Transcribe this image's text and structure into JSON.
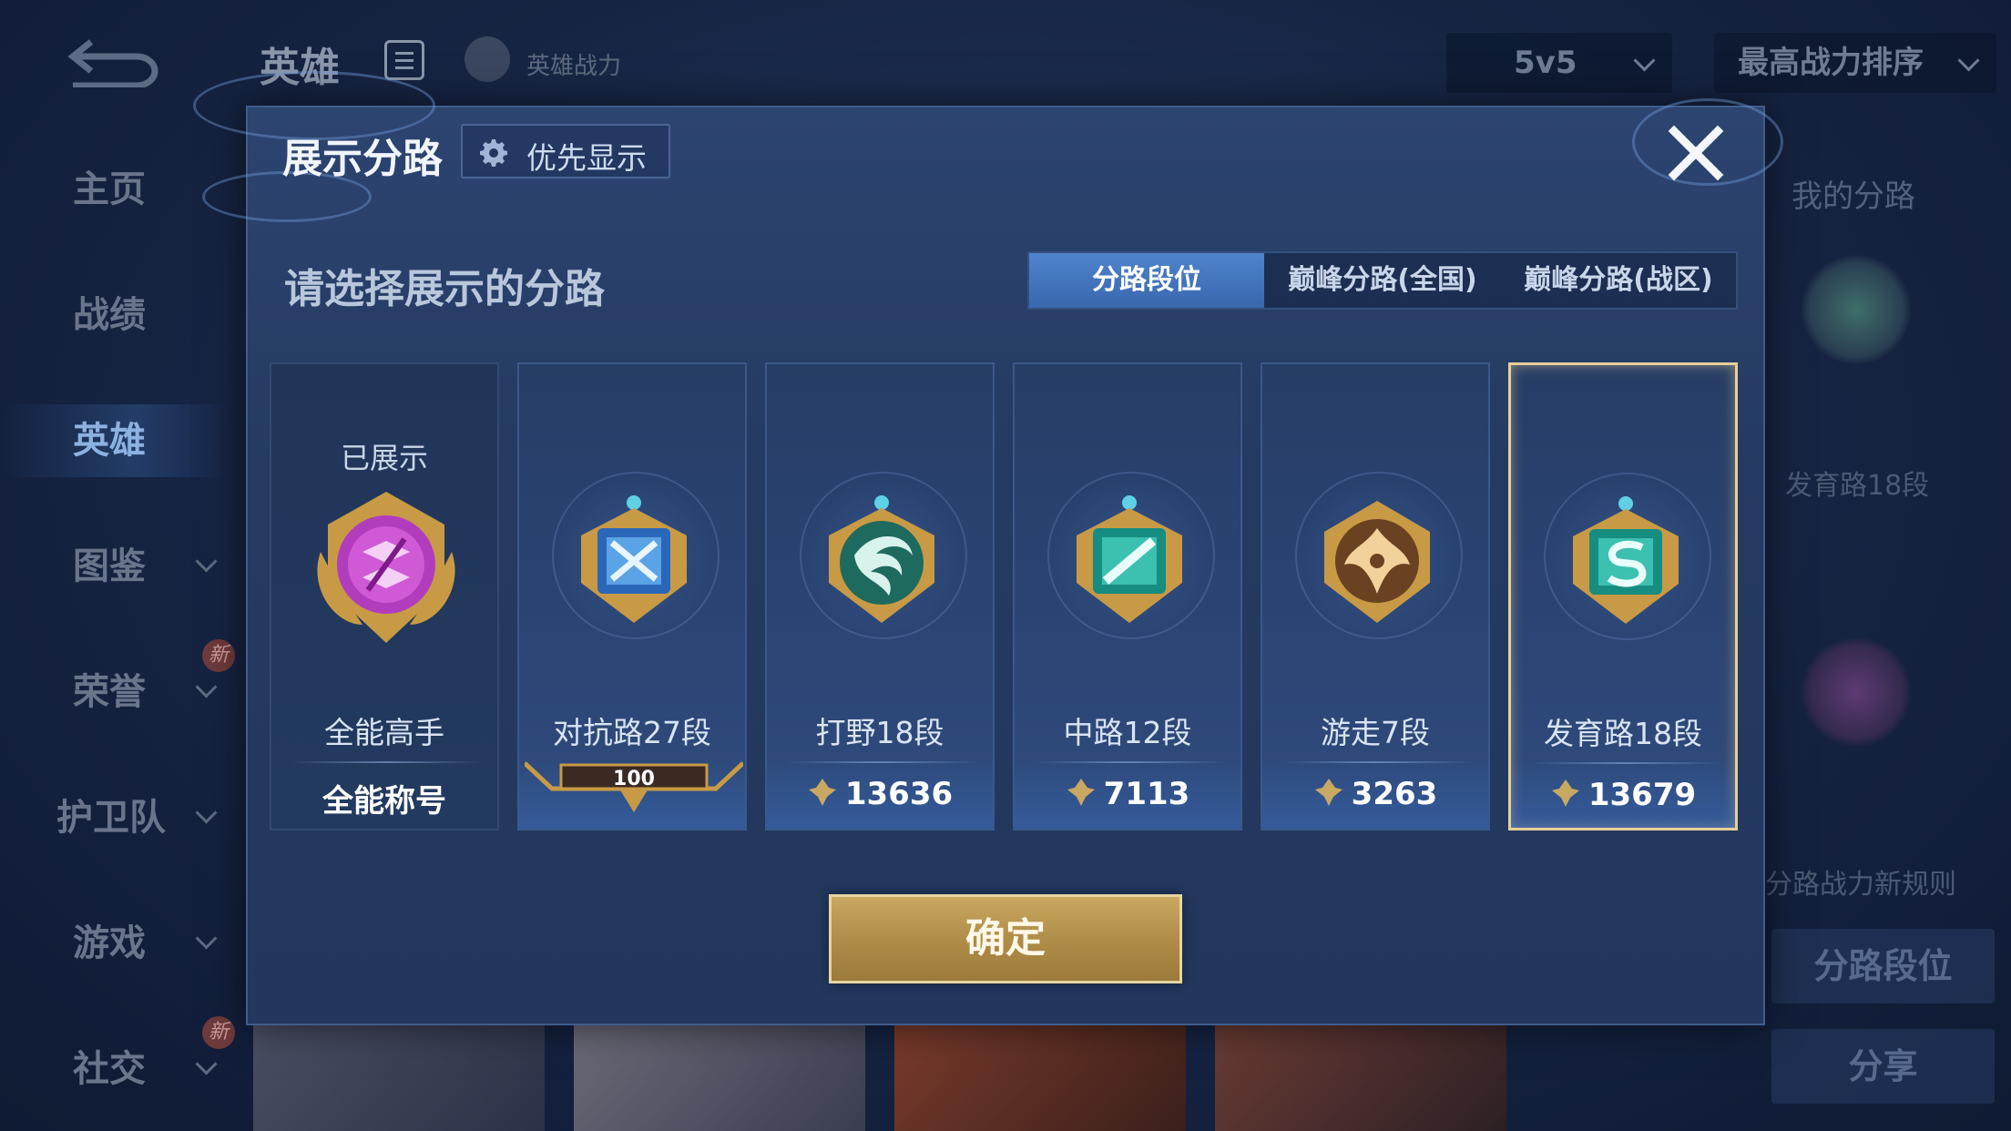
{
  "background": {
    "top_title": "英雄",
    "top_subtitle": "英雄战力",
    "mode_dropdown": "5v5",
    "sort_dropdown": "最高战力排序",
    "nav": [
      {
        "label": "主页",
        "active": false
      },
      {
        "label": "战绩",
        "active": false
      },
      {
        "label": "英雄",
        "active": true
      },
      {
        "label": "图鉴",
        "active": false
      },
      {
        "label": "荣誉",
        "active": false
      },
      {
        "label": "护卫队",
        "active": false
      },
      {
        "label": "游戏",
        "active": false
      },
      {
        "label": "社交",
        "active": false
      }
    ],
    "new_badge": "新",
    "right_panel": {
      "title": "我的分路",
      "lane_text": "发育路18段",
      "rule_link": "分路战力新规则",
      "lane_button": "分路段位",
      "share_button": "分享"
    }
  },
  "modal": {
    "title": "展示分路",
    "priority_button": "优先显示",
    "prompt": "请选择展示的分路",
    "tabs": [
      {
        "label": "分路段位",
        "active": true
      },
      {
        "label": "巅峰分路(全国)",
        "active": false
      },
      {
        "label": "巅峰分路(战区)",
        "active": false
      }
    ],
    "cards": [
      {
        "name": "全能高手",
        "status": "已展示",
        "footer": "全能称号",
        "medal": "allround-medal-icon"
      },
      {
        "name": "对抗路27段",
        "footer": "100",
        "medal": "clash-lane-medal-icon"
      },
      {
        "name": "打野18段",
        "score": "13636",
        "medal": "jungle-medal-icon"
      },
      {
        "name": "中路12段",
        "score": "7113",
        "medal": "mid-lane-medal-icon"
      },
      {
        "name": "游走7段",
        "score": "3263",
        "medal": "roam-medal-icon"
      },
      {
        "name": "发育路18段",
        "score": "13679",
        "medal": "farm-lane-medal-icon",
        "selected": true
      }
    ],
    "confirm_button": "确定"
  },
  "colors": {
    "accent_blue": "#4f84cc",
    "gold": "#c9a862",
    "selected_border": "#e8cf98"
  }
}
